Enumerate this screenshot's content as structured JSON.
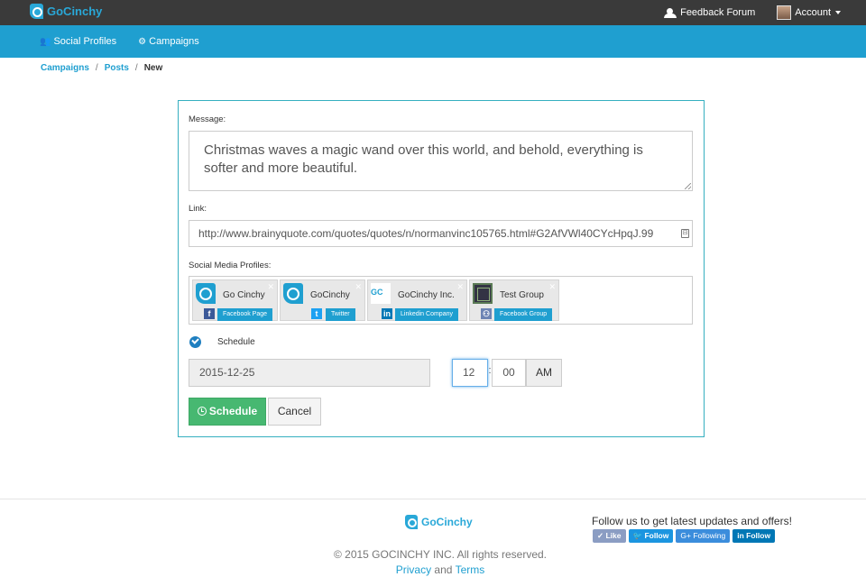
{
  "brand": {
    "name": "GoCinchy",
    "color": "#29a8d8"
  },
  "topbar": {
    "feedback_label": "Feedback Forum",
    "account_label": "Account"
  },
  "nav": {
    "social_profiles": "Social Profiles",
    "campaigns": "Campaigns"
  },
  "breadcrumb": {
    "campaigns": "Campaigns",
    "posts": "Posts",
    "current": "New",
    "sep": "/"
  },
  "form": {
    "message_label": "Message:",
    "message_value": "Christmas waves a magic wand over this world, and behold, everything is softer and more beautiful.",
    "link_label": "Link:",
    "link_value": "http://www.brainyquote.com/quotes/quotes/n/normanvinc105765.html#G2AfVWl40CYcHpqJ.99",
    "profiles_label": "Social Media Profiles:",
    "profiles": [
      {
        "name": "Go Cinchy",
        "type": "Facebook Page",
        "network_icon": "facebook-page-icon"
      },
      {
        "name": "GoCinchy",
        "type": "Twitter",
        "network_icon": "twitter-icon"
      },
      {
        "name": "GoCinchy Inc.",
        "type": "Linkedin Company",
        "network_icon": "linkedin-icon"
      },
      {
        "name": "Test Group",
        "type": "Facebook Group",
        "network_icon": "facebook-group-icon"
      }
    ],
    "schedule_label": "Schedule",
    "schedule_checked": true,
    "date_value": "2015-12-25",
    "hour_value": "12",
    "time_sep": ":",
    "minute_value": "00",
    "ampm_value": "AM",
    "schedule_button": "Schedule",
    "cancel_button": "Cancel"
  },
  "footer": {
    "copyright": "© 2015 GOCINCHY INC. All rights reserved.",
    "privacy": "Privacy",
    "and": "and",
    "terms": "Terms",
    "follow_text": "Follow us to get latest updates and offers!",
    "like": "Like",
    "twitter_follow": "Follow",
    "gplus": "Following",
    "linkedin_follow": "Follow"
  },
  "colors": {
    "topbar": "#3a3a3a",
    "navbar": "#1f9fd0",
    "panel_border": "#35afc0",
    "schedule_button": "#47b871"
  }
}
